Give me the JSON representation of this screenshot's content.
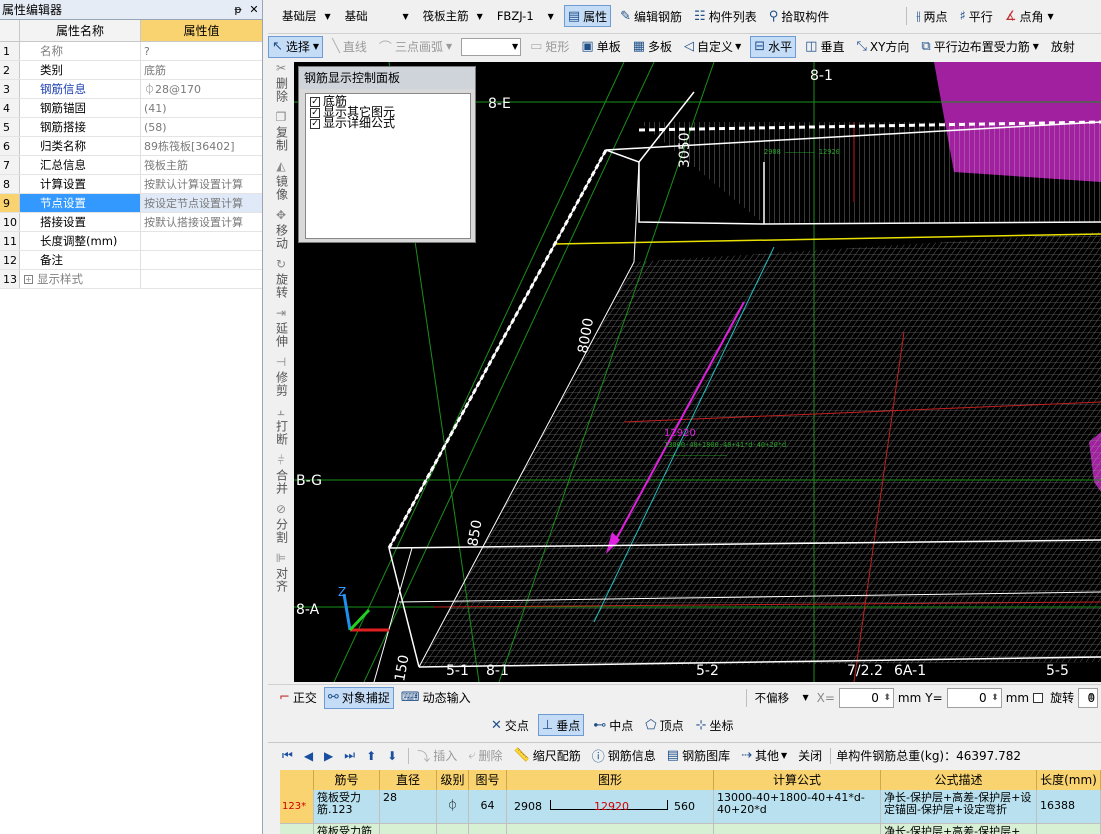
{
  "property_editor": {
    "title": "属性编辑器",
    "pin_label": "ᵽ",
    "close_label": "✕",
    "col_name": "属性名称",
    "col_value": "属性值",
    "rows": [
      {
        "idx": "1",
        "name": "名称",
        "value": "?",
        "style": "gray"
      },
      {
        "idx": "2",
        "name": "类别",
        "value": "底筋",
        "style": ""
      },
      {
        "idx": "3",
        "name": "钢筋信息",
        "value": "⏀28@170",
        "style": "blue"
      },
      {
        "idx": "4",
        "name": "钢筋锚固",
        "value": "(41)",
        "style": ""
      },
      {
        "idx": "5",
        "name": "钢筋搭接",
        "value": "(58)",
        "style": ""
      },
      {
        "idx": "6",
        "name": "归类名称",
        "value": "89栋筏板[36402]",
        "style": ""
      },
      {
        "idx": "7",
        "name": "汇总信息",
        "value": "筏板主筋",
        "style": ""
      },
      {
        "idx": "8",
        "name": "计算设置",
        "value": "按默认计算设置计算",
        "style": ""
      },
      {
        "idx": "9",
        "name": "节点设置",
        "value": "按设定节点设置计算",
        "style": "sel"
      },
      {
        "idx": "10",
        "name": "搭接设置",
        "value": "按默认搭接设置计算",
        "style": ""
      },
      {
        "idx": "11",
        "name": "长度调整(mm)",
        "value": "",
        "style": ""
      },
      {
        "idx": "12",
        "name": "备注",
        "value": "",
        "style": ""
      },
      {
        "idx": "13",
        "name": "显示样式",
        "value": "",
        "style": "gray",
        "expandable": true
      }
    ]
  },
  "toolbar1": {
    "layer": "基础层",
    "category": "基础",
    "type": "筏板主筋",
    "component": "FBZJ-1",
    "props_label": "属性",
    "edit_rebar_label": "编辑钢筋",
    "component_list_label": "构件列表",
    "pick_label": "拾取构件",
    "two_point_label": "两点",
    "parallel_label": "平行",
    "point_angle_label": "点角"
  },
  "toolbar2": {
    "select_label": "选择",
    "line_label": "直线",
    "arc_label": "三点画弧",
    "rect_label": "矩形",
    "single_board_label": "单板",
    "multi_board_label": "多板",
    "custom_label": "自定义",
    "horizontal_label": "水平",
    "vertical_label": "垂直",
    "xy_label": "XY方向",
    "parallel_edge_label": "平行边布置受力筋",
    "radial_label": "放射"
  },
  "vertical_toolbar": [
    {
      "name": "delete",
      "label": "删除",
      "icon": "✂"
    },
    {
      "name": "copy",
      "label": "复制",
      "icon": "❐"
    },
    {
      "name": "mirror",
      "label": "镜像",
      "icon": "◭"
    },
    {
      "name": "move",
      "label": "移动",
      "icon": "✥"
    },
    {
      "name": "rotate",
      "label": "旋转",
      "icon": "↻"
    },
    {
      "name": "extend",
      "label": "延伸",
      "icon": "⇥"
    },
    {
      "name": "trim",
      "label": "修剪",
      "icon": "⊣"
    },
    {
      "name": "break",
      "label": "打断",
      "icon": "⫠"
    },
    {
      "name": "merge",
      "label": "合并",
      "icon": "⫩"
    },
    {
      "name": "split",
      "label": "分割",
      "icon": "⊘"
    },
    {
      "name": "align",
      "label": "对齐",
      "icon": "⊫"
    }
  ],
  "rebar_panel": {
    "title": "钢筋显示控制面板",
    "options": [
      {
        "label": "底筋",
        "checked": true
      },
      {
        "label": "显示其它图元",
        "checked": true
      },
      {
        "label": "显示详细公式",
        "checked": true
      }
    ]
  },
  "canvas": {
    "axis_labels": [
      "8-E",
      "8-1",
      "B-G",
      "8-A",
      "5-1",
      "8-1",
      "5-2",
      "7/2.2",
      "6A-1",
      "5-5"
    ],
    "dims": [
      "3050",
      "8000",
      "850",
      "150",
      "12920"
    ]
  },
  "snapbar": {
    "ortho_label": "正交",
    "snap_label": "对象捕捉",
    "dyn_input_label": "动态输入",
    "offset_label": "不偏移",
    "x_label": "X=",
    "x_value": "0",
    "mm1": "mm",
    "y_label": "Y=",
    "y_value": "0",
    "mm2": "mm",
    "rotate_label": "旋转",
    "rotate_value": "0"
  },
  "snapbar2": {
    "intersect_label": "交点",
    "perp_label": "垂点",
    "mid_label": "中点",
    "vertex_label": "顶点",
    "coord_label": "坐标"
  },
  "table_toolbar": {
    "insert_label": "插入",
    "delete_label": "删除",
    "scale_label": "缩尺配筋",
    "info_label": "钢筋信息",
    "library_label": "钢筋图库",
    "other_label": "其他",
    "close_label": "关闭",
    "total_label": "单构件钢筋总重(kg)：46397.782"
  },
  "rebar_table": {
    "headers": [
      "筋号",
      "直径(mm)",
      "级别",
      "图号",
      "图形",
      "计算公式",
      "公式描述",
      "长度(mm)"
    ],
    "rows": [
      {
        "idx": "123*",
        "name": "筏板受力筋.123",
        "diameter": "28",
        "grade": "⏀",
        "fig_no": "64",
        "shape_left": "2908",
        "shape_mid": "12920",
        "shape_right": "560",
        "formula": "13000-40+1800-40+41*d-40+20*d",
        "desc": "净长-保护层+高差-保护层+设定锚固-保护层+设定弯折",
        "length": "16388"
      }
    ],
    "partial_row_name": "筏板受力筋",
    "partial_row_desc": "净长-保护层+高差-保护层+"
  }
}
